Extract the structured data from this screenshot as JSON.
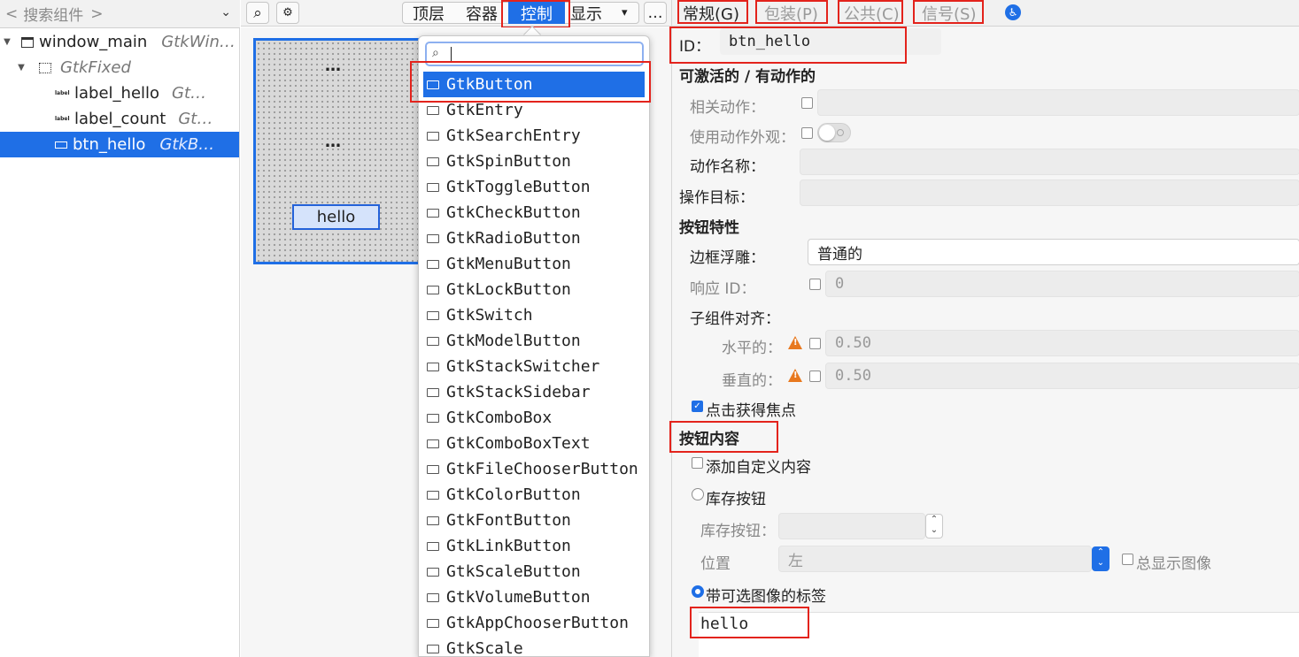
{
  "left": {
    "search_prefix": "<",
    "search_placeholder": "搜索组件",
    "search_suffix": ">",
    "tree": [
      {
        "name": "window_main",
        "type": "GtkWin…"
      },
      {
        "name": "",
        "type": "GtkFixed"
      },
      {
        "name": "label_hello",
        "type": "Gt…"
      },
      {
        "name": "label_count",
        "type": "Gt…"
      },
      {
        "name": "btn_hello",
        "type": "GtkB…"
      }
    ]
  },
  "toolbar": {
    "tabs": [
      "顶层",
      "容器",
      "控制",
      "显示"
    ],
    "more": "…",
    "dropdown_arrow": "▾"
  },
  "canvas": {
    "dots1": "…",
    "dots2": "…",
    "button_label": "hello"
  },
  "popup": {
    "items": [
      "GtkButton",
      "GtkEntry",
      "GtkSearchEntry",
      "GtkSpinButton",
      "GtkToggleButton",
      "GtkCheckButton",
      "GtkRadioButton",
      "GtkMenuButton",
      "GtkLockButton",
      "GtkSwitch",
      "GtkModelButton",
      "GtkStackSwitcher",
      "GtkStackSidebar",
      "GtkComboBox",
      "GtkComboBoxText",
      "GtkFileChooserButton",
      "GtkColorButton",
      "GtkFontButton",
      "GtkLinkButton",
      "GtkScaleButton",
      "GtkVolumeButton",
      "GtkAppChooserButton",
      "GtkScale"
    ]
  },
  "props": {
    "tabs": [
      "常规(G)",
      "包装(P)",
      "公共(C)",
      "信号(S)"
    ],
    "id_label": "ID：",
    "id_value": "btn_hello",
    "section_activatable": "可激活的 / 有动作的",
    "related_action": "相关动作：",
    "use_action_appearance": "使用动作外观：",
    "action_name": "动作名称：",
    "action_target": "操作目标：",
    "section_button": "按钮特性",
    "relief": "边框浮雕：",
    "relief_value": "普通的",
    "response_id": "响应 ID：",
    "response_id_value": "0",
    "child_align": "子组件对齐：",
    "horizontal": "水平的：",
    "horizontal_value": "0.50",
    "vertical": "垂直的：",
    "vertical_value": "0.50",
    "focus_on_click": "点击获得焦点",
    "section_content": "按钮内容",
    "custom_content": "添加自定义内容",
    "stock_button_radio": "库存按钮",
    "stock_button_label": "库存按钮：",
    "position_label": "位置",
    "position_value": "左",
    "always_show_image": "总显示图像",
    "label_with_image": "带可选图像的标签",
    "label_value": "hello"
  }
}
